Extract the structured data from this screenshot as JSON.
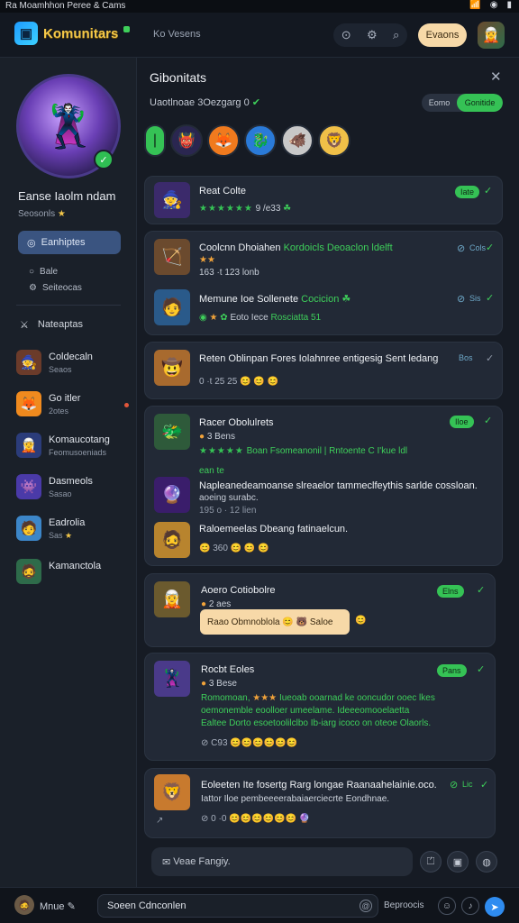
{
  "status_bar": {
    "title": "Ra Moamhhon Peree & Cams",
    "icons": [
      "📶",
      "◉",
      "▮"
    ]
  },
  "header": {
    "logo": "Komunitars",
    "search": "Ko Vesens",
    "button": "Evaons"
  },
  "sidebar": {
    "profile_name": "Eanse Iaolm ndam",
    "profile_sub": "Seosonls",
    "primary_label": "Eanhiptes",
    "links": [
      "Bale",
      "Seiteocas"
    ],
    "section": "Nateaptas",
    "games": [
      {
        "name": "Coldecaln",
        "sub": "Seaos"
      },
      {
        "name": "Go itler",
        "sub": "2otes"
      },
      {
        "name": "Komaucotang",
        "sub": "Feomusoeniads"
      },
      {
        "name": "Dasmeols",
        "sub": "Sasao"
      },
      {
        "name": "Eadrolia",
        "sub": "Sas"
      },
      {
        "name": "Kamanctola",
        "sub": ""
      }
    ]
  },
  "panel": {
    "title": "Gibonitats",
    "subtitle": "Uaotlnoae 3Oezgarg 0",
    "toggle_off": "Eomo",
    "toggle_on": "Gonitide"
  },
  "posts": [
    {
      "title": "Reat Colte",
      "score": "9 /e33",
      "pill": "Iate"
    },
    {
      "title": "Coolcnn Dhoiahen",
      "title_hl": "Kordoicls Deoaclon ldelft",
      "line1": "163 ·t 123 lonb",
      "pill": "Cols"
    },
    {
      "title": "Memune Ioe Sollenete",
      "title_hl": "Cocicion",
      "line1": "Eoto Iece",
      "line1_hl": "Rosciatta 51",
      "pill": "Sis"
    },
    {
      "title": "Reten Oblinpan Fores Iolahnree entigesig Sent ledang",
      "pill": "Bos",
      "react": "0 ·t 25 25"
    },
    {
      "title": "Racer Obolulrets",
      "sub": "3 Bens",
      "line1_hl": "Boan Fsomeanonil | Rntoente C I'kue ldl",
      "line2": "ean te",
      "pill": "Iloe"
    },
    {
      "title": "Napleanedeamoanse slreaelor tammeclfeythis sarlde cossloan.",
      "line1": "aoeing surabc.",
      "line2": "195 o · 12 lien"
    },
    {
      "title": "Raloemeelas Dbeang fatinaelcun.",
      "react": "360"
    },
    {
      "title": "Aoero Cotiobolre",
      "sub": "2 aes",
      "bubble": "Raao Obmnoblola",
      "bubble_end": "Saloe",
      "pill": "Elns"
    },
    {
      "title": "Rocbt Eoles",
      "sub": "3 Bese",
      "line1": "Romomoan,",
      "line1_hl": "Iueoab ooarnad ke ooncudor ooec lkes",
      "line2": "oemonemble eoolloer umeelame. Ideeeomooelaetta",
      "line3": "Ealtee Dorto esoetoolilclbo Ib-iarg icoco on oteoe Olaorls.",
      "react": "C93",
      "pill": "Pans"
    },
    {
      "title": "Eoleeten Ite fosertg Rarg longae Raanaahelainie.oco.",
      "line1": "Iattor Iloe pembeeeerabaiaerciecrte Eondhnae.",
      "react": "0 ·0",
      "pill": "Lic"
    }
  ],
  "composer": {
    "placeholder": "Veae Fangiy."
  },
  "bottom_bar": {
    "user": "Mnue",
    "input": "Soeen Cdnconlen",
    "label": "Beproocis"
  }
}
